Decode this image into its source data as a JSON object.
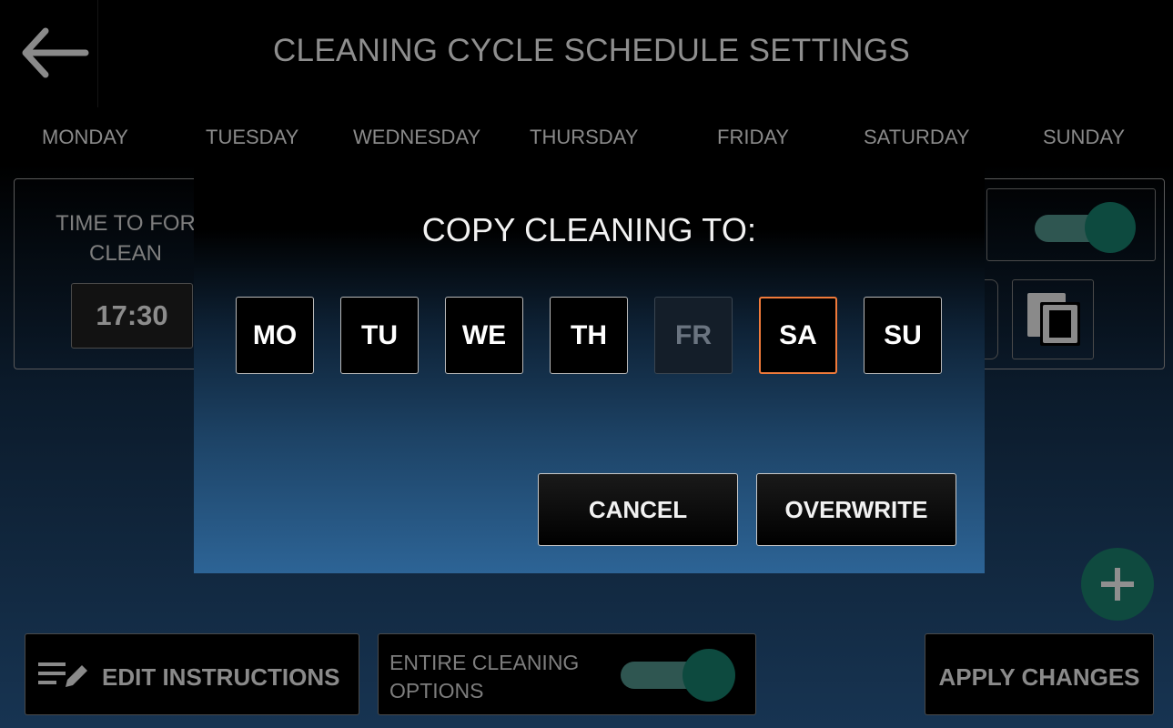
{
  "header": {
    "title": "CLEANING CYCLE SCHEDULE SETTINGS",
    "back_icon": "arrow-left-icon"
  },
  "days": [
    "MONDAY",
    "TUESDAY",
    "WEDNESDAY",
    "THURSDAY",
    "FRIDAY",
    "SATURDAY",
    "SUNDAY"
  ],
  "card": {
    "label": "TIME TO FORCE CLEAN",
    "label_visible": "TIME TO FOR\nCLEAN",
    "time": "17:30",
    "toggle_on": true,
    "copy_icon": "copy-icon"
  },
  "modal": {
    "title": "COPY CLEANING TO:",
    "days": [
      {
        "label": "MO",
        "state": "normal"
      },
      {
        "label": "TU",
        "state": "normal"
      },
      {
        "label": "WE",
        "state": "normal"
      },
      {
        "label": "TH",
        "state": "normal"
      },
      {
        "label": "FR",
        "state": "disabled"
      },
      {
        "label": "SA",
        "state": "selected"
      },
      {
        "label": "SU",
        "state": "normal"
      }
    ],
    "cancel_label": "CANCEL",
    "overwrite_label": "OVERWRITE"
  },
  "bottom": {
    "edit_label": "EDIT INSTRUCTIONS",
    "edit_icon": "edit-notes-icon",
    "options_label": "ENTIRE CLEANING OPTIONS",
    "options_line1": "ENTIRE CLEANING",
    "options_line2": "OPTIONS",
    "options_toggle_on": true,
    "apply_label": "APPLY CHANGES"
  },
  "fab_icon": "plus-icon",
  "colors": {
    "selected_border": "#f07a3a",
    "toggle_knob": "#0d4a3f",
    "toggle_track": "#2f5651",
    "fab": "#0f4a3f"
  }
}
